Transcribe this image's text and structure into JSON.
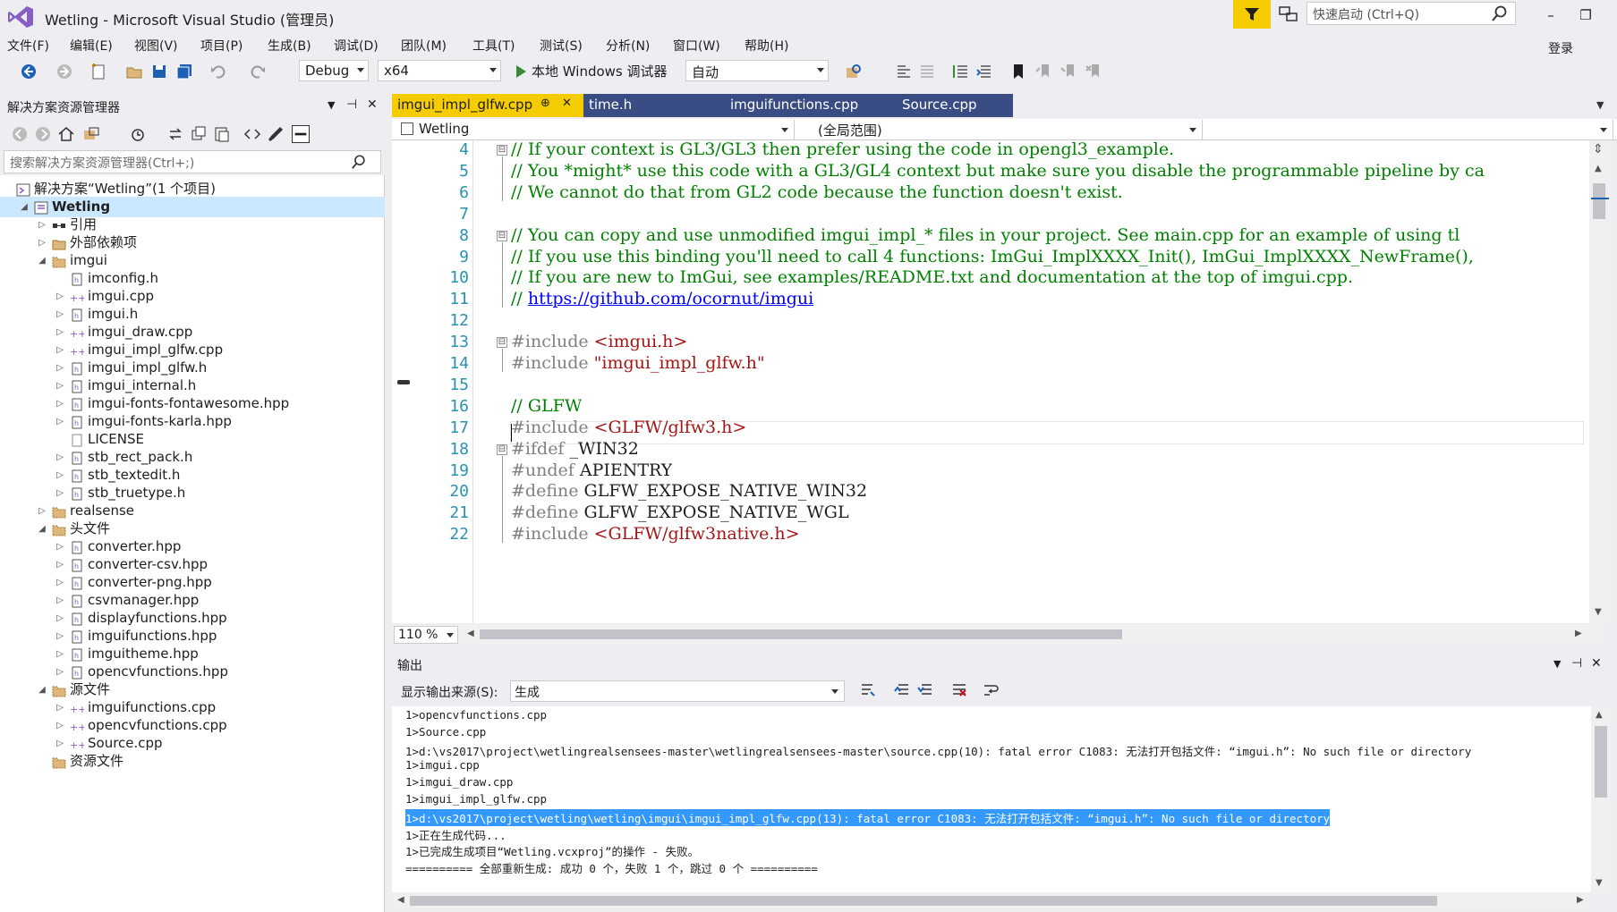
{
  "window": {
    "title": "Wetling - Microsoft Visual Studio (管理员)",
    "quick_launch_placeholder": "快速启动 (Ctrl+Q)",
    "sign_in": "登录",
    "minimize": "–",
    "maximize": "❐"
  },
  "menu": [
    "文件(F)",
    "编辑(E)",
    "视图(V)",
    "项目(P)",
    "生成(B)",
    "调试(D)",
    "团队(M)",
    "工具(T)",
    "测试(S)",
    "分析(N)",
    "窗口(W)",
    "帮助(H)"
  ],
  "toolbar": {
    "config": "Debug",
    "platform": "x64",
    "debugger": "本地 Windows 调试器",
    "debugger_mode": "自动"
  },
  "solution_explorer": {
    "title": "解决方案资源管理器",
    "search_placeholder": "搜索解决方案资源管理器(Ctrl+;)",
    "items": [
      {
        "label": "解决方案“Wetling”(1 个项目)",
        "depth": 0,
        "icon": "solution-icon",
        "exp": ""
      },
      {
        "label": "Wetling",
        "depth": 1,
        "icon": "project-icon",
        "exp": "◢",
        "selected": true
      },
      {
        "label": "引用",
        "depth": 2,
        "icon": "references-icon",
        "exp": "▷"
      },
      {
        "label": "外部依赖项",
        "depth": 2,
        "icon": "external-deps-icon",
        "exp": "▷"
      },
      {
        "label": "imgui",
        "depth": 2,
        "icon": "folder-icon",
        "exp": "◢"
      },
      {
        "label": "imconfig.h",
        "depth": 3,
        "icon": "header-file-icon",
        "exp": ""
      },
      {
        "label": "imgui.cpp",
        "depth": 3,
        "icon": "cpp-file-icon",
        "exp": "▷"
      },
      {
        "label": "imgui.h",
        "depth": 3,
        "icon": "header-file-icon",
        "exp": "▷"
      },
      {
        "label": "imgui_draw.cpp",
        "depth": 3,
        "icon": "cpp-file-icon",
        "exp": "▷"
      },
      {
        "label": "imgui_impl_glfw.cpp",
        "depth": 3,
        "icon": "cpp-file-icon",
        "exp": "▷"
      },
      {
        "label": "imgui_impl_glfw.h",
        "depth": 3,
        "icon": "header-file-icon",
        "exp": "▷"
      },
      {
        "label": "imgui_internal.h",
        "depth": 3,
        "icon": "header-file-icon",
        "exp": "▷"
      },
      {
        "label": "imgui-fonts-fontawesome.hpp",
        "depth": 3,
        "icon": "header-file-icon",
        "exp": "▷"
      },
      {
        "label": "imgui-fonts-karla.hpp",
        "depth": 3,
        "icon": "header-file-icon",
        "exp": "▷"
      },
      {
        "label": "LICENSE",
        "depth": 3,
        "icon": "text-file-icon",
        "exp": ""
      },
      {
        "label": "stb_rect_pack.h",
        "depth": 3,
        "icon": "header-file-icon",
        "exp": "▷"
      },
      {
        "label": "stb_textedit.h",
        "depth": 3,
        "icon": "header-file-icon",
        "exp": "▷"
      },
      {
        "label": "stb_truetype.h",
        "depth": 3,
        "icon": "header-file-icon",
        "exp": "▷"
      },
      {
        "label": "realsense",
        "depth": 2,
        "icon": "folder-icon",
        "exp": "▷"
      },
      {
        "label": "头文件",
        "depth": 2,
        "icon": "folder-icon",
        "exp": "◢"
      },
      {
        "label": "converter.hpp",
        "depth": 3,
        "icon": "header-file-icon",
        "exp": "▷"
      },
      {
        "label": "converter-csv.hpp",
        "depth": 3,
        "icon": "header-file-icon",
        "exp": "▷"
      },
      {
        "label": "converter-png.hpp",
        "depth": 3,
        "icon": "header-file-icon",
        "exp": "▷"
      },
      {
        "label": "csvmanager.hpp",
        "depth": 3,
        "icon": "header-file-icon",
        "exp": "▷"
      },
      {
        "label": "displayfunctions.hpp",
        "depth": 3,
        "icon": "header-file-icon",
        "exp": "▷"
      },
      {
        "label": "imguifunctions.hpp",
        "depth": 3,
        "icon": "header-file-icon",
        "exp": "▷"
      },
      {
        "label": "imguitheme.hpp",
        "depth": 3,
        "icon": "header-file-icon",
        "exp": "▷"
      },
      {
        "label": "opencvfunctions.hpp",
        "depth": 3,
        "icon": "header-file-icon",
        "exp": "▷"
      },
      {
        "label": "源文件",
        "depth": 2,
        "icon": "folder-icon",
        "exp": "◢"
      },
      {
        "label": "imguifunctions.cpp",
        "depth": 3,
        "icon": "cpp-file-icon",
        "exp": "▷"
      },
      {
        "label": "opencvfunctions.cpp",
        "depth": 3,
        "icon": "cpp-file-icon",
        "exp": "▷"
      },
      {
        "label": "Source.cpp",
        "depth": 3,
        "icon": "cpp-file-icon",
        "exp": "▷"
      },
      {
        "label": "资源文件",
        "depth": 2,
        "icon": "folder-icon",
        "exp": ""
      }
    ]
  },
  "editor": {
    "tabs": [
      {
        "label": "imgui_impl_glfw.cpp",
        "active": true,
        "pin": "⊕",
        "close": "✕"
      },
      {
        "label": "time.h",
        "active": false
      },
      {
        "label": "imguifunctions.cpp",
        "active": false
      },
      {
        "label": "Source.cpp",
        "active": false
      }
    ],
    "nav_project": "Wetling",
    "nav_scope": "(全局范围)",
    "zoom": "110 %",
    "lines": [
      {
        "n": "4",
        "parts": [
          {
            "t": "// If your context is GL3/GL3 then prefer using the code in opengl3_example.",
            "c": "cm"
          }
        ],
        "fold": "⊟"
      },
      {
        "n": "5",
        "parts": [
          {
            "t": "// You *might* use this code with a GL3/GL4 context but make sure you disable the programmable pipeline by ca",
            "c": "cm"
          }
        ]
      },
      {
        "n": "6",
        "parts": [
          {
            "t": "// We cannot do that from GL2 code because the function doesn't exist.",
            "c": "cm"
          }
        ]
      },
      {
        "n": "7",
        "parts": []
      },
      {
        "n": "8",
        "parts": [
          {
            "t": "// You can copy and use unmodified imgui_impl_* files in your project. See main.cpp for an example of using tl",
            "c": "cm"
          }
        ],
        "fold": "⊟"
      },
      {
        "n": "9",
        "parts": [
          {
            "t": "// If you use this binding you'll need to call 4 functions: ImGui_ImplXXXX_Init(), ImGui_ImplXXXX_NewFrame(),",
            "c": "cm"
          }
        ]
      },
      {
        "n": "10",
        "parts": [
          {
            "t": "// If you are new to ImGui, see examples/README.txt and documentation at the top of imgui.cpp.",
            "c": "cm"
          }
        ]
      },
      {
        "n": "11",
        "parts": [
          {
            "t": "// ",
            "c": "cm"
          },
          {
            "t": "https://github.com/ocornut/imgui",
            "c": "lnk"
          }
        ]
      },
      {
        "n": "12",
        "parts": []
      },
      {
        "n": "13",
        "parts": [
          {
            "t": "#include ",
            "c": "pp"
          },
          {
            "t": "<imgui.h>",
            "c": "str"
          }
        ],
        "fold": "⊟"
      },
      {
        "n": "14",
        "parts": [
          {
            "t": "#include ",
            "c": "pp"
          },
          {
            "t": "\"imgui_impl_glfw.h\"",
            "c": "str"
          }
        ]
      },
      {
        "n": "15",
        "parts": []
      },
      {
        "n": "16",
        "parts": [
          {
            "t": "// GLFW",
            "c": "cm"
          }
        ]
      },
      {
        "n": "17",
        "parts": [
          {
            "t": "#include ",
            "c": "pp"
          },
          {
            "t": "<GLFW/glfw3.h>",
            "c": "str"
          }
        ]
      },
      {
        "n": "18",
        "parts": [
          {
            "t": "#ifdef ",
            "c": "pp"
          },
          {
            "t": "_WIN32",
            "c": ""
          }
        ],
        "fold": "⊟"
      },
      {
        "n": "19",
        "parts": [
          {
            "t": "#undef ",
            "c": "pp"
          },
          {
            "t": "APIENTRY",
            "c": ""
          }
        ]
      },
      {
        "n": "20",
        "parts": [
          {
            "t": "#define ",
            "c": "pp"
          },
          {
            "t": "GLFW_EXPOSE_NATIVE_WIN32",
            "c": ""
          }
        ]
      },
      {
        "n": "21",
        "parts": [
          {
            "t": "#define ",
            "c": "pp"
          },
          {
            "t": "GLFW_EXPOSE_NATIVE_WGL",
            "c": ""
          }
        ]
      },
      {
        "n": "22",
        "parts": [
          {
            "t": "#include ",
            "c": "pp"
          },
          {
            "t": "<GLFW/glfw3native.h>",
            "c": "str"
          }
        ]
      }
    ]
  },
  "output": {
    "title": "输出",
    "source_label": "显示输出来源(S):",
    "source": "生成",
    "lines": [
      {
        "t": "1>opencvfunctions.cpp"
      },
      {
        "t": "1>Source.cpp"
      },
      {
        "t": "1>d:\\vs2017\\project\\wetlingrealsensees-master\\wetlingrealsensees-master\\source.cpp(10): fatal error C1083: 无法打开包括文件: “imgui.h”: No such file or directory"
      },
      {
        "t": "1>imgui.cpp"
      },
      {
        "t": "1>imgui_draw.cpp"
      },
      {
        "t": "1>imgui_impl_glfw.cpp"
      },
      {
        "t": "1>d:\\vs2017\\project\\wetling\\wetling\\imgui\\imgui_impl_glfw.cpp(13): fatal error C1083: 无法打开包括文件: “imgui.h”: No such file or directory",
        "hl": true
      },
      {
        "t": "1>正在生成代码..."
      },
      {
        "t": "1>已完成生成项目“Wetling.vcxproj”的操作 - 失败。"
      },
      {
        "t": "========== 全部重新生成: 成功 0 个，失败 1 个，跳过 0 个 =========="
      }
    ]
  },
  "colors": {
    "accent_yellow": "#f5cc00",
    "tab_inactive": "#3a4c84",
    "selection": "#3399ff"
  }
}
